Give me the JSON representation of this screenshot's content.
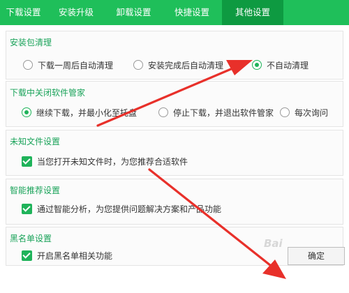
{
  "tabs": [
    {
      "label": "下载设置"
    },
    {
      "label": "安装升级"
    },
    {
      "label": "卸载设置"
    },
    {
      "label": "快捷设置"
    },
    {
      "label": "其他设置",
      "active": true
    }
  ],
  "sections": {
    "install_cleanup": {
      "title": "安装包清理",
      "options": [
        {
          "label": "下载一周后自动清理",
          "selected": false
        },
        {
          "label": "安装完成后自动清理",
          "selected": false
        },
        {
          "label": "不自动清理",
          "selected": true
        }
      ]
    },
    "close_during_download": {
      "title": "下载中关闭软件管家",
      "options": [
        {
          "label": "继续下载，并最小化至托盘",
          "selected": true
        },
        {
          "label": "停止下载，并退出软件管家",
          "selected": false
        },
        {
          "label": "每次询问",
          "selected": false
        }
      ]
    },
    "unknown_files": {
      "title": "未知文件设置",
      "checkbox_label": "当您打开未知文件时，为您推荐合适软件",
      "checked": true
    },
    "smart_recommend": {
      "title": "智能推荐设置",
      "checkbox_label": "通过智能分析，为您提供问题解决方案和产品功能",
      "checked": true
    },
    "blacklist": {
      "title": "黑名单设置",
      "checkbox_label": "开启黑名单相关功能",
      "checked": true
    }
  },
  "confirm_button": "确定",
  "watermark": "Bai",
  "colors": {
    "tab_bg": "#1fbf5a",
    "tab_active_bg": "#0e9a41",
    "accent": "#1fb35a",
    "section_title": "#1aa35a",
    "arrow": "#e8302a"
  }
}
